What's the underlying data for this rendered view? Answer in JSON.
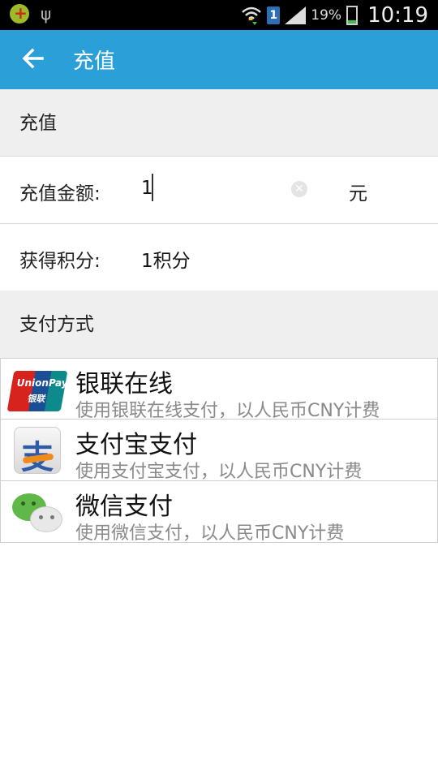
{
  "status_bar": {
    "sim_slot": "1",
    "battery_percent": "19%",
    "time": "10:19"
  },
  "app_bar": {
    "title": "充值"
  },
  "recharge_section": {
    "header": "充值",
    "amount_label": "充值金额:",
    "amount_value": "1",
    "amount_unit": "元",
    "points_label": "获得积分:",
    "points_value": "1积分"
  },
  "payment_section": {
    "header": "支付方式",
    "methods": [
      {
        "title": "银联在线",
        "subtitle": "使用银联在线支付，以人民币CNY计费",
        "icon": "unionpay-icon",
        "logo_text": "UnionPay",
        "logo_text_cn": "银联"
      },
      {
        "title": "支付宝支付",
        "subtitle": "使用支付宝支付，以人民币CNY计费",
        "icon": "alipay-icon",
        "logo_text": "支"
      },
      {
        "title": "微信支付",
        "subtitle": "使用微信支付，以人民币CNY计费",
        "icon": "wechat-icon"
      }
    ]
  },
  "colors": {
    "app_bar": "#2a9fd8",
    "section_bg": "#efefef",
    "status_bar": "#000000"
  }
}
